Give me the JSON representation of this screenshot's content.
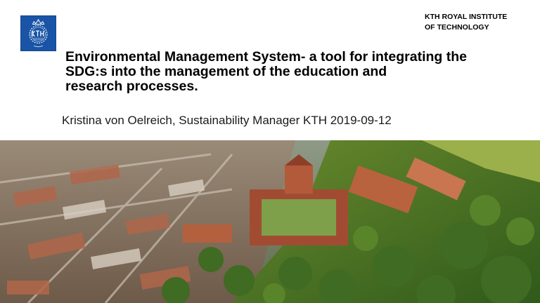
{
  "header": {
    "logo": {
      "icon": "kth-crest-icon",
      "text": "KTH",
      "color": "#1954a6"
    },
    "institution_line1": "KTH ROYAL INSTITUTE",
    "institution_line2": "OF TECHNOLOGY"
  },
  "slide": {
    "title_line1": "Environmental Management System- a tool for integrating the",
    "title_line2": "SDG:s into the management of the education and",
    "title_line3": "research processes.",
    "subtitle": "Kristina von Oelreich, Sustainability Manager  KTH  2019-09-12"
  },
  "photo": {
    "subject": "aerial-campus-photo"
  }
}
